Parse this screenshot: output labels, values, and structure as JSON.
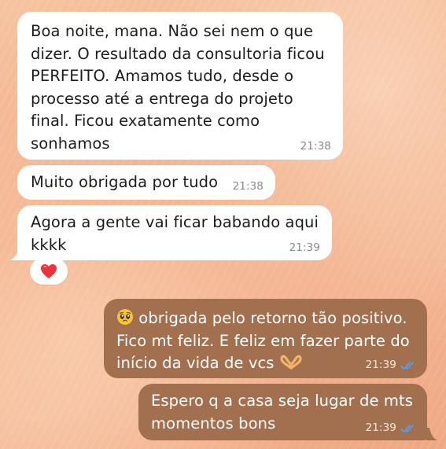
{
  "messages": [
    {
      "direction": "incoming",
      "text": "Boa noite, mana. Não sei nem o que\ndizer. O resultado da consultoria ficou\nPERFEITO. Amamos tudo, desde o\nprocesso até a entrega do projeto\nfinal. Ficou exatamente como\nsonhamos",
      "time": "21:38"
    },
    {
      "direction": "incoming",
      "text": "Muito obrigada por tudo",
      "time": "21:38"
    },
    {
      "direction": "incoming",
      "text": "Agora a gente vai ficar babando aqui\nkkkk",
      "time": "21:39",
      "reaction": "heart-emoji"
    },
    {
      "direction": "outgoing",
      "leading_emoji": "pleading-face-emoji",
      "text_line1": " obrigada pelo retorno tão positivo.",
      "text_rest": "Fico mt feliz. E feliz em fazer parte do\ninício da vida de vcs ",
      "trailing_emoji": "heart-hands-emoji",
      "time": "21:39",
      "status": "read-double-check"
    },
    {
      "direction": "outgoing",
      "text": "Espero q a casa seja lugar de mts\nmomentos bons",
      "time": "21:39",
      "status": "read-double-check"
    }
  ],
  "colors": {
    "incoming_bubble": "#ffffff",
    "outgoing_bubble": "#a2704f",
    "read_ticks": "#4fa3ff",
    "wallpaper": "#f2ae88"
  }
}
